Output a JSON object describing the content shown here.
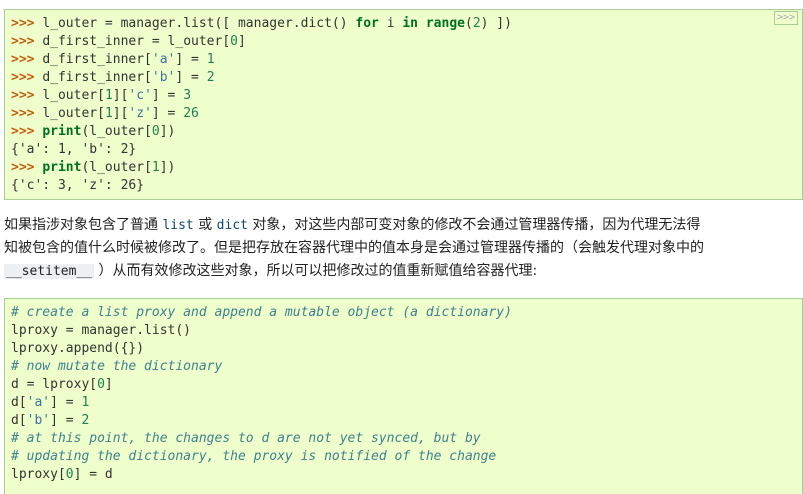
{
  "copy_button_label": ">>>",
  "code1": {
    "lines": [
      [
        {
          "t": "prompt",
          "v": ">>> "
        },
        {
          "t": "plain",
          "v": "l_outer = manager.list([ manager.dict() "
        },
        {
          "t": "kw",
          "v": "for"
        },
        {
          "t": "plain",
          "v": " i "
        },
        {
          "t": "kw",
          "v": "in"
        },
        {
          "t": "plain",
          "v": " "
        },
        {
          "t": "bi",
          "v": "range"
        },
        {
          "t": "plain",
          "v": "("
        },
        {
          "t": "num",
          "v": "2"
        },
        {
          "t": "plain",
          "v": ") ])"
        }
      ],
      [
        {
          "t": "prompt",
          "v": ">>> "
        },
        {
          "t": "plain",
          "v": "d_first_inner = l_outer["
        },
        {
          "t": "num",
          "v": "0"
        },
        {
          "t": "plain",
          "v": "]"
        }
      ],
      [
        {
          "t": "prompt",
          "v": ">>> "
        },
        {
          "t": "plain",
          "v": "d_first_inner["
        },
        {
          "t": "str",
          "v": "'a'"
        },
        {
          "t": "plain",
          "v": "] = "
        },
        {
          "t": "num",
          "v": "1"
        }
      ],
      [
        {
          "t": "prompt",
          "v": ">>> "
        },
        {
          "t": "plain",
          "v": "d_first_inner["
        },
        {
          "t": "str",
          "v": "'b'"
        },
        {
          "t": "plain",
          "v": "] = "
        },
        {
          "t": "num",
          "v": "2"
        }
      ],
      [
        {
          "t": "prompt",
          "v": ">>> "
        },
        {
          "t": "plain",
          "v": "l_outer["
        },
        {
          "t": "num",
          "v": "1"
        },
        {
          "t": "plain",
          "v": "]["
        },
        {
          "t": "str",
          "v": "'c'"
        },
        {
          "t": "plain",
          "v": "] = "
        },
        {
          "t": "num",
          "v": "3"
        }
      ],
      [
        {
          "t": "prompt",
          "v": ">>> "
        },
        {
          "t": "plain",
          "v": "l_outer["
        },
        {
          "t": "num",
          "v": "1"
        },
        {
          "t": "plain",
          "v": "]["
        },
        {
          "t": "str",
          "v": "'z'"
        },
        {
          "t": "plain",
          "v": "] = "
        },
        {
          "t": "num",
          "v": "26"
        }
      ],
      [
        {
          "t": "prompt",
          "v": ">>> "
        },
        {
          "t": "bi",
          "v": "print"
        },
        {
          "t": "plain",
          "v": "(l_outer["
        },
        {
          "t": "num",
          "v": "0"
        },
        {
          "t": "plain",
          "v": "])"
        }
      ],
      [
        {
          "t": "out",
          "v": "{'a': 1, 'b': 2}"
        }
      ],
      [
        {
          "t": "prompt",
          "v": ">>> "
        },
        {
          "t": "bi",
          "v": "print"
        },
        {
          "t": "plain",
          "v": "(l_outer["
        },
        {
          "t": "num",
          "v": "1"
        },
        {
          "t": "plain",
          "v": "])"
        }
      ],
      [
        {
          "t": "out",
          "v": "{'c': 3, 'z': 26}"
        }
      ]
    ]
  },
  "paragraph": {
    "line1_a": "如果指涉对象包含了普通 ",
    "line1_code1": "list",
    "line1_b": " 或 ",
    "line1_code2": "dict",
    "line1_c": " 对象，对这些内部可变对象的修改不会通过管理器传播，因为代理无法得",
    "line2": "知被包含的值什么时候被修改了。但是把存放在容器代理中的值本身是会通过管理器传播的（会触发代理对象中的",
    "line3_code": "__setitem__",
    "line3_b": " ）从而有效修改这些对象，所以可以把修改过的值重新赋值给容器代理:"
  },
  "code2": {
    "lines": [
      [
        {
          "t": "cmt",
          "v": "# create a list proxy and append a mutable object (a dictionary)"
        }
      ],
      [
        {
          "t": "plain",
          "v": "lproxy = manager.list()"
        }
      ],
      [
        {
          "t": "plain",
          "v": "lproxy.append({})"
        }
      ],
      [
        {
          "t": "cmt",
          "v": "# now mutate the dictionary"
        }
      ],
      [
        {
          "t": "plain",
          "v": "d = lproxy["
        },
        {
          "t": "num",
          "v": "0"
        },
        {
          "t": "plain",
          "v": "]"
        }
      ],
      [
        {
          "t": "plain",
          "v": "d["
        },
        {
          "t": "str",
          "v": "'a'"
        },
        {
          "t": "plain",
          "v": "] = "
        },
        {
          "t": "num",
          "v": "1"
        }
      ],
      [
        {
          "t": "plain",
          "v": "d["
        },
        {
          "t": "str",
          "v": "'b'"
        },
        {
          "t": "plain",
          "v": "] = "
        },
        {
          "t": "num",
          "v": "2"
        }
      ],
      [
        {
          "t": "cmt",
          "v": "# at this point, the changes to d are not yet synced, but by"
        }
      ],
      [
        {
          "t": "cmt",
          "v": "# updating the dictionary, the proxy is notified of the change"
        }
      ],
      [
        {
          "t": "plain",
          "v": "lproxy["
        },
        {
          "t": "num",
          "v": "0"
        },
        {
          "t": "plain",
          "v": "] = d"
        }
      ]
    ]
  }
}
